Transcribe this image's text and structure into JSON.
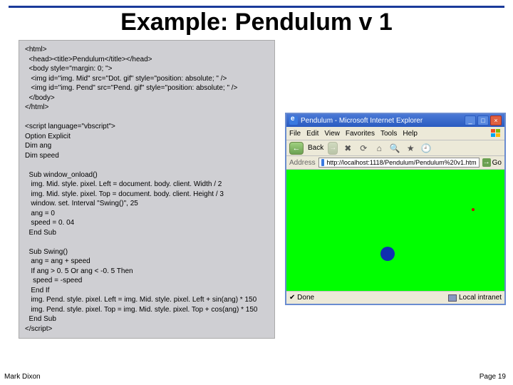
{
  "title": "Example: Pendulum v 1",
  "code": "<html>\n  <head><title>Pendulum</title></head>\n  <body style=\"margin: 0; \">\n   <img id=\"img. Mid\" src=\"Dot. gif\" style=\"position: absolute; \" />\n   <img id=\"img. Pend\" src=\"Pend. gif\" style=\"position: absolute; \" />\n  </body>\n</html>\n\n<script language=\"vbscript\">\nOption Explicit\nDim ang\nDim speed\n\n  Sub window_onload()\n   img. Mid. style. pixel. Left = document. body. client. Width / 2\n   img. Mid. style. pixel. Top = document. body. client. Height / 3\n   window. set. Interval \"Swing()\", 25\n   ang = 0\n   speed = 0. 04\n  End Sub\n\n  Sub Swing()\n   ang = ang + speed\n   If ang > 0. 5 Or ang < -0. 5 Then\n    speed = -speed\n   End If\n   img. Pend. style. pixel. Left = img. Mid. style. pixel. Left + sin(ang) * 150\n   img. Pend. style. pixel. Top = img. Mid. style. pixel. Top + cos(ang) * 150\n  End Sub\n</script>",
  "browser": {
    "window_title": "Pendulum - Microsoft Internet Explorer",
    "menu": {
      "file": "File",
      "edit": "Edit",
      "view": "View",
      "favorites": "Favorites",
      "tools": "Tools",
      "help": "Help"
    },
    "toolbar": {
      "back": "Back"
    },
    "address_label": "Address",
    "url": "http://localhost:1118/Pendulum/Pendulum%20v1.htm",
    "go": "Go",
    "status_left": "Done",
    "status_right": "Local intranet"
  },
  "footer": {
    "left": "Mark Dixon",
    "right": "Page 19"
  }
}
